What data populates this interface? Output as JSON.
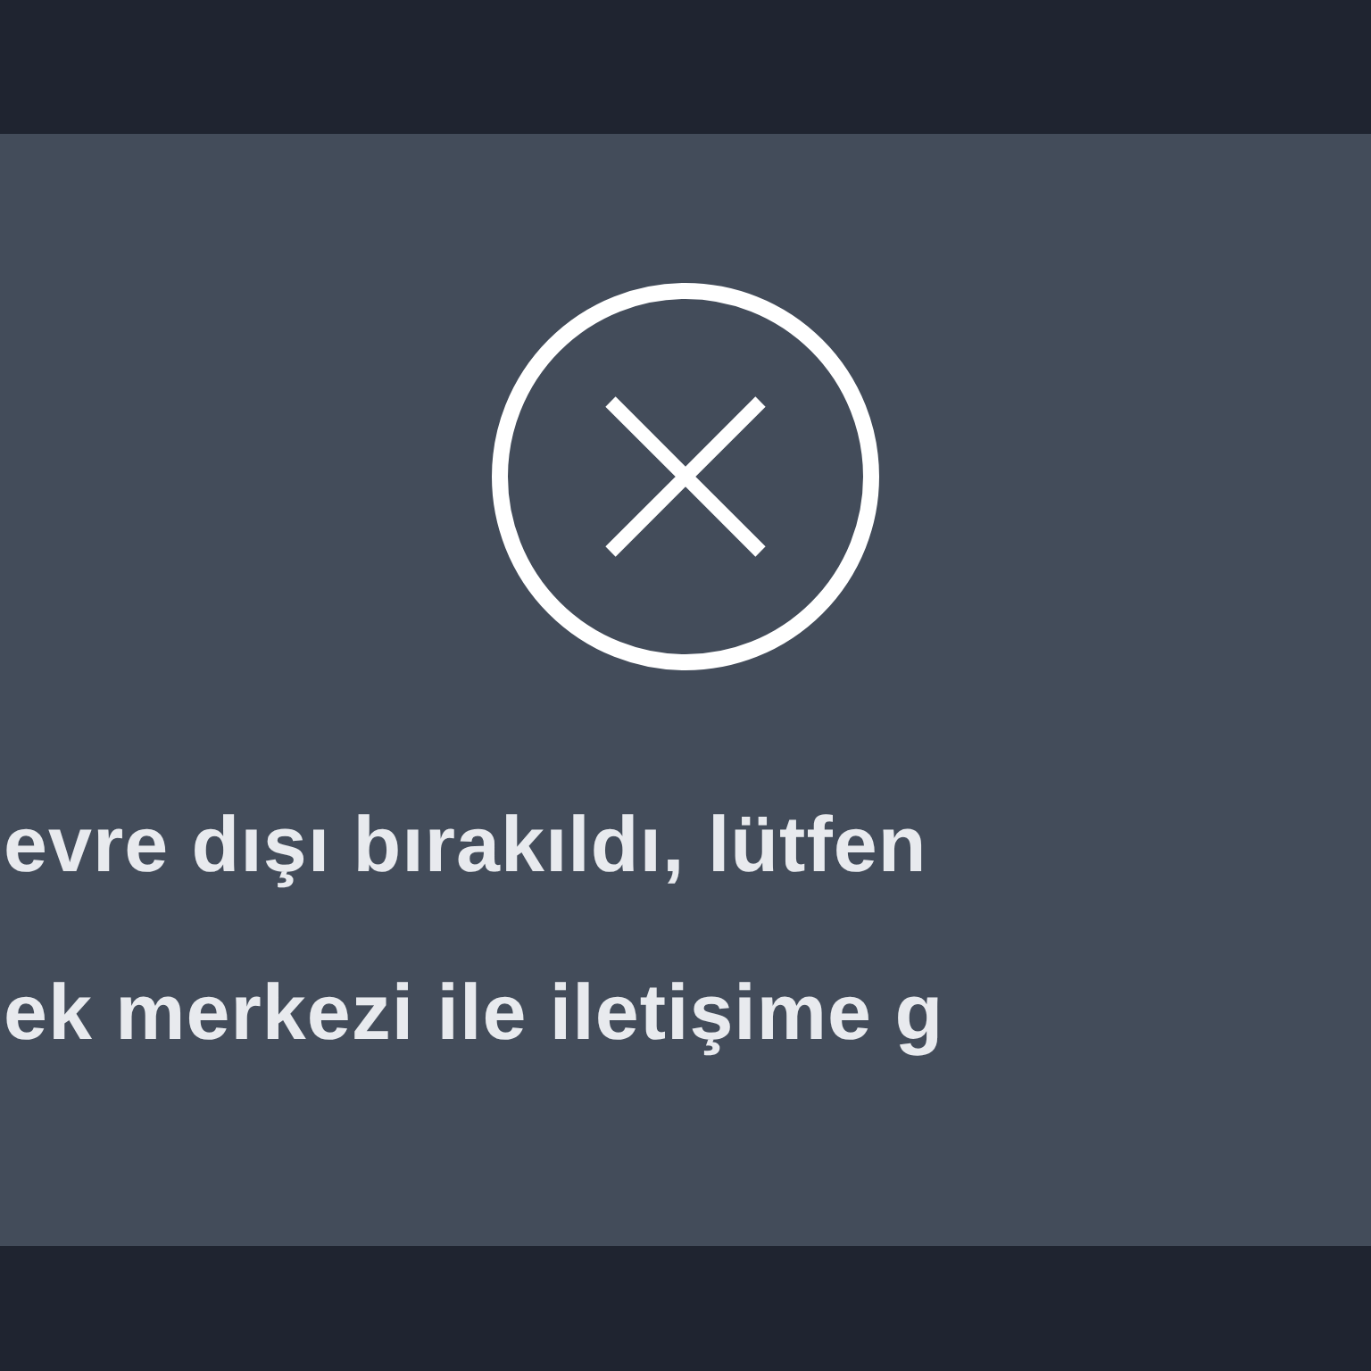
{
  "message": {
    "lines": [
      "evre dışı bırakıldı, lütfen",
      "ek merkezi ile iletişime g"
    ]
  }
}
